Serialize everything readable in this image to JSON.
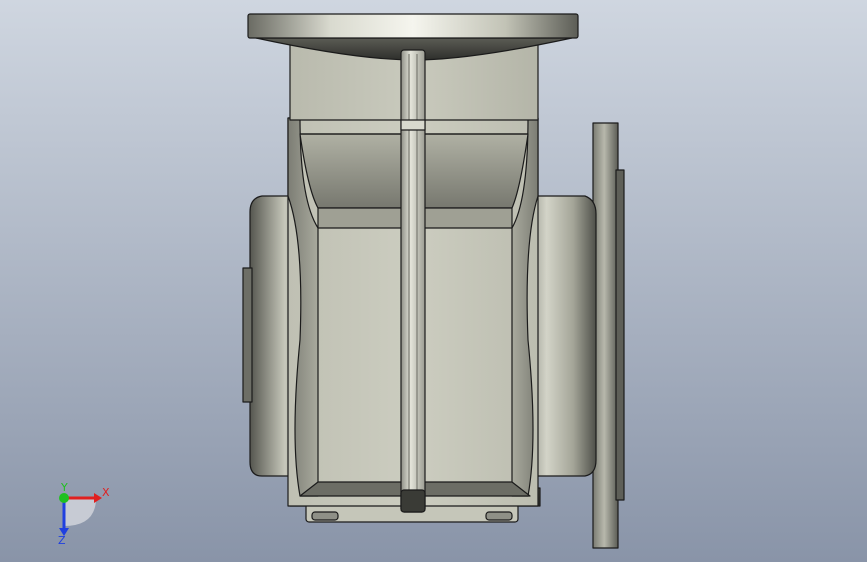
{
  "viewport": {
    "background_top": "#cfd6e0",
    "background_bottom": "#8994a8"
  },
  "model": {
    "body_color": "#c9cabb",
    "shadow_color": "#6e6f66",
    "highlight_color": "#f2f2ea",
    "edge_color": "#1b1b1b"
  },
  "triad": {
    "x_label": "X",
    "y_label": "Y",
    "z_label": "Z",
    "x_color": "#e02020",
    "y_color": "#20c020",
    "z_color": "#2040e0"
  }
}
